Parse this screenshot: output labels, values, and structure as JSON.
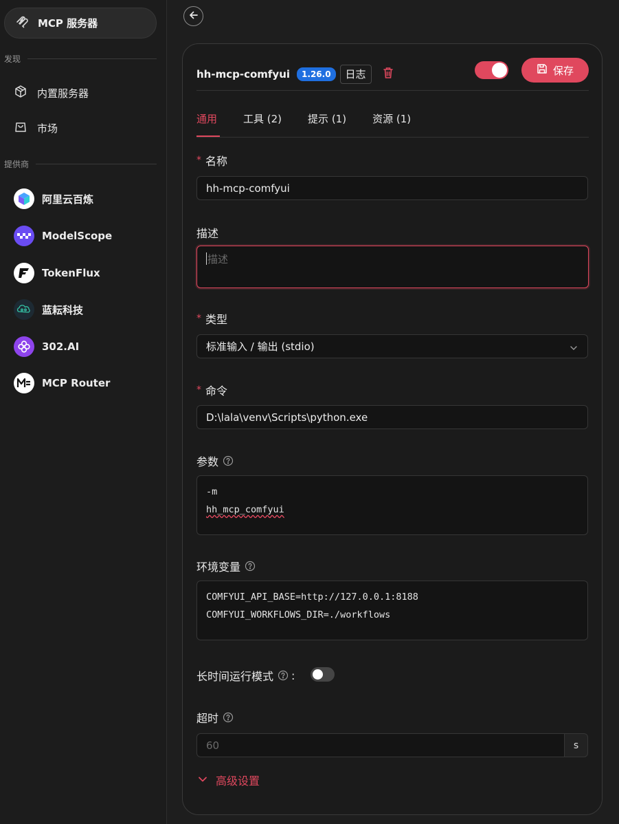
{
  "sidebar": {
    "mcp_label": "MCP 服务器",
    "section_discover": "发现",
    "nav_builtin": "内置服务器",
    "nav_market": "市场",
    "section_providers": "提供商",
    "providers": [
      {
        "name": "阿里云百炼",
        "color": "#2b7cf0"
      },
      {
        "name": "ModelScope",
        "color": "#6a4cf2"
      },
      {
        "name": "TokenFlux",
        "color": "#ffffff"
      },
      {
        "name": "蓝耘科技",
        "color": "#2aa8a0"
      },
      {
        "name": "302.AI",
        "color": "#8e44ec"
      },
      {
        "name": "MCP Router",
        "color": "#ffffff"
      }
    ]
  },
  "header": {
    "server_name": "hh-mcp-comfyui",
    "version": "1.26.0",
    "log_label": "日志",
    "save_label": "保存",
    "enabled": true
  },
  "tabs": [
    {
      "label": "通用",
      "active": true
    },
    {
      "label": "工具 (2)",
      "active": false
    },
    {
      "label": "提示 (1)",
      "active": false
    },
    {
      "label": "资源 (1)",
      "active": false
    }
  ],
  "form": {
    "name_label": "名称",
    "name_value": "hh-mcp-comfyui",
    "desc_label": "描述",
    "desc_placeholder": "描述",
    "type_label": "类型",
    "type_value": "标准输入 / 输出 (stdio)",
    "command_label": "命令",
    "command_value": "D:\\lala\\venv\\Scripts\\python.exe",
    "args_label": "参数",
    "args_lines": [
      "-m",
      "hh_mcp_comfyui"
    ],
    "env_label": "环境变量",
    "env_lines": [
      "COMFYUI_API_BASE=http://127.0.0.1:8188",
      "COMFYUI_WORKFLOWS_DIR=./workflows"
    ],
    "long_running_label": "长时间运行模式",
    "long_running_colon": ":",
    "long_running_enabled": false,
    "timeout_label": "超时",
    "timeout_placeholder": "60",
    "timeout_unit": "s",
    "advanced_label": "高级设置"
  },
  "colors": {
    "accent": "#e0485e",
    "badge": "#1f6fe0"
  }
}
